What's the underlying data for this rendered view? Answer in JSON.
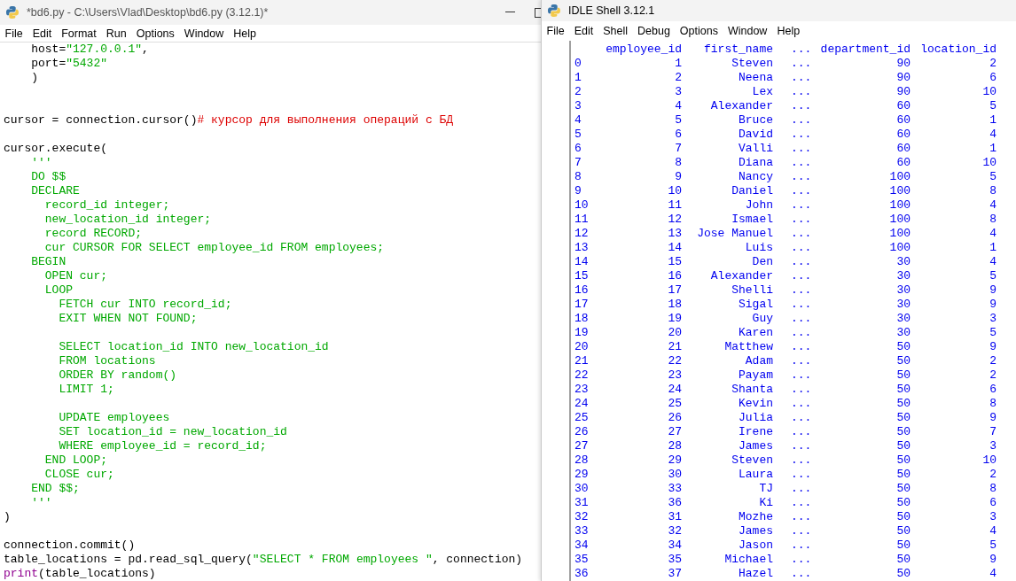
{
  "editor_window": {
    "title": "*bd6.py - C:\\Users\\Vlad\\Desktop\\bd6.py (3.12.1)*",
    "menu": [
      "File",
      "Edit",
      "Format",
      "Run",
      "Options",
      "Window",
      "Help"
    ],
    "code_lines": [
      {
        "kind": "code",
        "segments": [
          {
            "text": "    host=",
            "kind": "plain"
          },
          {
            "text": "\"127.0.0.1\"",
            "kind": "string"
          },
          {
            "text": ",",
            "kind": "plain"
          }
        ]
      },
      {
        "kind": "code",
        "segments": [
          {
            "text": "    port=",
            "kind": "plain"
          },
          {
            "text": "\"5432\"",
            "kind": "string"
          }
        ]
      },
      {
        "kind": "code",
        "segments": [
          {
            "text": "    )",
            "kind": "plain"
          }
        ]
      },
      {
        "kind": "blank"
      },
      {
        "kind": "blank"
      },
      {
        "kind": "code",
        "segments": [
          {
            "text": "cursor = connection.cursor()",
            "kind": "plain"
          },
          {
            "text": "# курсор для выполнения операций с БД",
            "kind": "comment"
          }
        ]
      },
      {
        "kind": "blank"
      },
      {
        "kind": "code",
        "segments": [
          {
            "text": "cursor.execute(",
            "kind": "plain"
          }
        ]
      },
      {
        "kind": "code",
        "segments": [
          {
            "text": "    '''",
            "kind": "string"
          }
        ]
      },
      {
        "kind": "code",
        "segments": [
          {
            "text": "    DO $$",
            "kind": "string"
          }
        ]
      },
      {
        "kind": "code",
        "segments": [
          {
            "text": "    DECLARE",
            "kind": "string"
          }
        ]
      },
      {
        "kind": "code",
        "segments": [
          {
            "text": "      record_id integer;",
            "kind": "string"
          }
        ]
      },
      {
        "kind": "code",
        "segments": [
          {
            "text": "      new_location_id integer;",
            "kind": "string"
          }
        ]
      },
      {
        "kind": "code",
        "segments": [
          {
            "text": "      record RECORD;",
            "kind": "string"
          }
        ]
      },
      {
        "kind": "code",
        "segments": [
          {
            "text": "      cur CURSOR FOR SELECT employee_id FROM employees;",
            "kind": "string"
          }
        ]
      },
      {
        "kind": "code",
        "segments": [
          {
            "text": "    BEGIN",
            "kind": "string"
          }
        ]
      },
      {
        "kind": "code",
        "segments": [
          {
            "text": "      OPEN cur;",
            "kind": "string"
          }
        ]
      },
      {
        "kind": "code",
        "segments": [
          {
            "text": "      LOOP",
            "kind": "string"
          }
        ]
      },
      {
        "kind": "code",
        "segments": [
          {
            "text": "        FETCH cur INTO record_id;",
            "kind": "string"
          }
        ]
      },
      {
        "kind": "code",
        "segments": [
          {
            "text": "        EXIT WHEN NOT FOUND;",
            "kind": "string"
          }
        ]
      },
      {
        "kind": "blank"
      },
      {
        "kind": "code",
        "segments": [
          {
            "text": "        SELECT location_id INTO new_location_id",
            "kind": "string"
          }
        ]
      },
      {
        "kind": "code",
        "segments": [
          {
            "text": "        FROM locations",
            "kind": "string"
          }
        ]
      },
      {
        "kind": "code",
        "segments": [
          {
            "text": "        ORDER BY random()",
            "kind": "string"
          }
        ]
      },
      {
        "kind": "code",
        "segments": [
          {
            "text": "        LIMIT 1;",
            "kind": "string"
          }
        ]
      },
      {
        "kind": "blank"
      },
      {
        "kind": "code",
        "segments": [
          {
            "text": "        UPDATE employees",
            "kind": "string"
          }
        ]
      },
      {
        "kind": "code",
        "segments": [
          {
            "text": "        SET location_id = new_location_id",
            "kind": "string"
          }
        ]
      },
      {
        "kind": "code",
        "segments": [
          {
            "text": "        WHERE employee_id = record_id;",
            "kind": "string"
          }
        ]
      },
      {
        "kind": "code",
        "segments": [
          {
            "text": "      END LOOP;",
            "kind": "string"
          }
        ]
      },
      {
        "kind": "code",
        "segments": [
          {
            "text": "      CLOSE cur;",
            "kind": "string"
          }
        ]
      },
      {
        "kind": "code",
        "segments": [
          {
            "text": "    END $$;",
            "kind": "string"
          }
        ]
      },
      {
        "kind": "code",
        "segments": [
          {
            "text": "    '''",
            "kind": "string"
          }
        ]
      },
      {
        "kind": "code",
        "segments": [
          {
            "text": ")",
            "kind": "plain"
          }
        ]
      },
      {
        "kind": "blank"
      },
      {
        "kind": "code",
        "segments": [
          {
            "text": "connection.commit()",
            "kind": "plain"
          }
        ]
      },
      {
        "kind": "code",
        "segments": [
          {
            "text": "table_locations = pd.read_sql_query(",
            "kind": "plain"
          },
          {
            "text": "\"SELECT * FROM employees \"",
            "kind": "string"
          },
          {
            "text": ", connection)",
            "kind": "plain"
          }
        ]
      },
      {
        "kind": "code",
        "segments": [
          {
            "text": "print",
            "kind": "builtin"
          },
          {
            "text": "(table_locations)",
            "kind": "plain"
          }
        ]
      }
    ]
  },
  "shell_window": {
    "title": "IDLE Shell 3.12.1",
    "menu": [
      "File",
      "Edit",
      "Shell",
      "Debug",
      "Options",
      "Window",
      "Help"
    ],
    "output": {
      "columns": [
        "",
        "employee_id",
        "first_name",
        "...",
        "department_id",
        "location_id"
      ],
      "rows": [
        [
          "0",
          "1",
          "Steven",
          "...",
          "90",
          "2"
        ],
        [
          "1",
          "2",
          "Neena",
          "...",
          "90",
          "6"
        ],
        [
          "2",
          "3",
          "Lex",
          "...",
          "90",
          "10"
        ],
        [
          "3",
          "4",
          "Alexander",
          "...",
          "60",
          "5"
        ],
        [
          "4",
          "5",
          "Bruce",
          "...",
          "60",
          "1"
        ],
        [
          "5",
          "6",
          "David",
          "...",
          "60",
          "4"
        ],
        [
          "6",
          "7",
          "Valli",
          "...",
          "60",
          "1"
        ],
        [
          "7",
          "8",
          "Diana",
          "...",
          "60",
          "10"
        ],
        [
          "8",
          "9",
          "Nancy",
          "...",
          "100",
          "5"
        ],
        [
          "9",
          "10",
          "Daniel",
          "...",
          "100",
          "8"
        ],
        [
          "10",
          "11",
          "John",
          "...",
          "100",
          "4"
        ],
        [
          "11",
          "12",
          "Ismael",
          "...",
          "100",
          "8"
        ],
        [
          "12",
          "13",
          "Jose Manuel",
          "...",
          "100",
          "4"
        ],
        [
          "13",
          "14",
          "Luis",
          "...",
          "100",
          "1"
        ],
        [
          "14",
          "15",
          "Den",
          "...",
          "30",
          "4"
        ],
        [
          "15",
          "16",
          "Alexander",
          "...",
          "30",
          "5"
        ],
        [
          "16",
          "17",
          "Shelli",
          "...",
          "30",
          "9"
        ],
        [
          "17",
          "18",
          "Sigal",
          "...",
          "30",
          "9"
        ],
        [
          "18",
          "19",
          "Guy",
          "...",
          "30",
          "3"
        ],
        [
          "19",
          "20",
          "Karen",
          "...",
          "30",
          "5"
        ],
        [
          "20",
          "21",
          "Matthew",
          "...",
          "50",
          "9"
        ],
        [
          "21",
          "22",
          "Adam",
          "...",
          "50",
          "2"
        ],
        [
          "22",
          "23",
          "Payam",
          "...",
          "50",
          "2"
        ],
        [
          "23",
          "24",
          "Shanta",
          "...",
          "50",
          "6"
        ],
        [
          "24",
          "25",
          "Kevin",
          "...",
          "50",
          "8"
        ],
        [
          "25",
          "26",
          "Julia",
          "...",
          "50",
          "9"
        ],
        [
          "26",
          "27",
          "Irene",
          "...",
          "50",
          "7"
        ],
        [
          "27",
          "28",
          "James",
          "...",
          "50",
          "3"
        ],
        [
          "28",
          "29",
          "Steven",
          "...",
          "50",
          "10"
        ],
        [
          "29",
          "30",
          "Laura",
          "...",
          "50",
          "2"
        ],
        [
          "30",
          "33",
          "TJ",
          "...",
          "50",
          "8"
        ],
        [
          "31",
          "36",
          "Ki",
          "...",
          "50",
          "6"
        ],
        [
          "32",
          "31",
          "Mozhe",
          "...",
          "50",
          "3"
        ],
        [
          "33",
          "32",
          "James",
          "...",
          "50",
          "4"
        ],
        [
          "34",
          "34",
          "Jason",
          "...",
          "50",
          "5"
        ],
        [
          "35",
          "35",
          "Michael",
          "...",
          "50",
          "9"
        ],
        [
          "36",
          "37",
          "Hazel",
          "...",
          "50",
          "4"
        ]
      ]
    }
  }
}
